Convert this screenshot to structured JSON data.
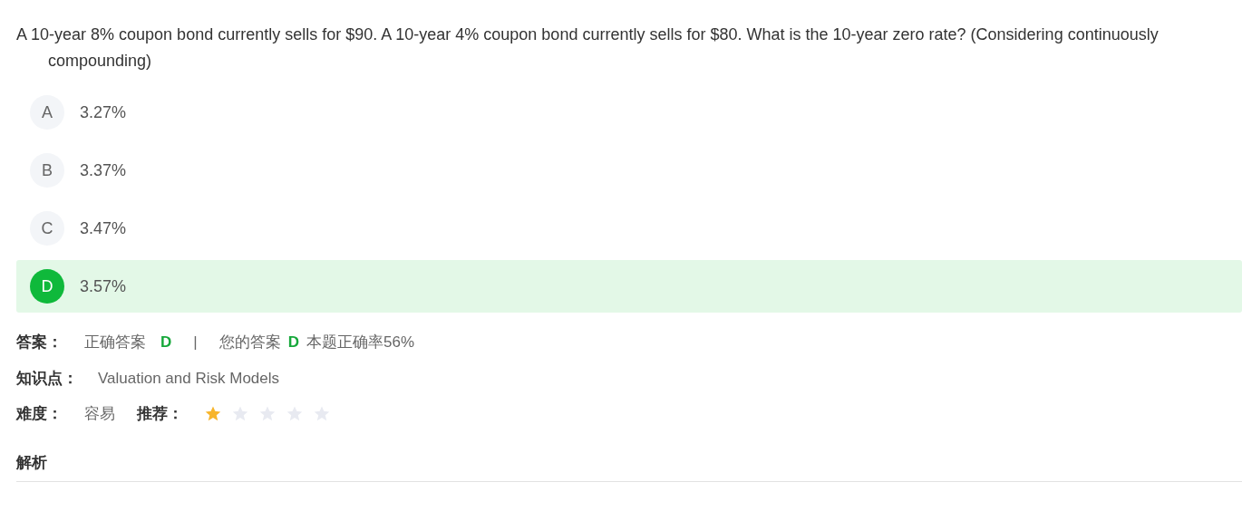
{
  "question": "A 10-year 8% coupon bond currently sells for $90. A 10-year 4% coupon bond currently sells for $80. What is the 10-year zero rate? (Considering continuously compounding)",
  "options": [
    {
      "letter": "A",
      "text": "3.27%",
      "selected": false
    },
    {
      "letter": "B",
      "text": "3.37%",
      "selected": false
    },
    {
      "letter": "C",
      "text": "3.47%",
      "selected": false
    },
    {
      "letter": "D",
      "text": "3.57%",
      "selected": true
    }
  ],
  "answer": {
    "label": "答案：",
    "correct_label": "正确答案",
    "correct": "D",
    "separator": "|",
    "yours_label": "您的答案",
    "yours": "D",
    "rate": "本题正确率56%"
  },
  "topic": {
    "label": "知识点：",
    "value": "Valuation and Risk Models"
  },
  "difficulty": {
    "label": "难度：",
    "value": "容易"
  },
  "recommend": {
    "label": "推荐：",
    "stars": 1
  },
  "analysis": {
    "title": "解析"
  }
}
